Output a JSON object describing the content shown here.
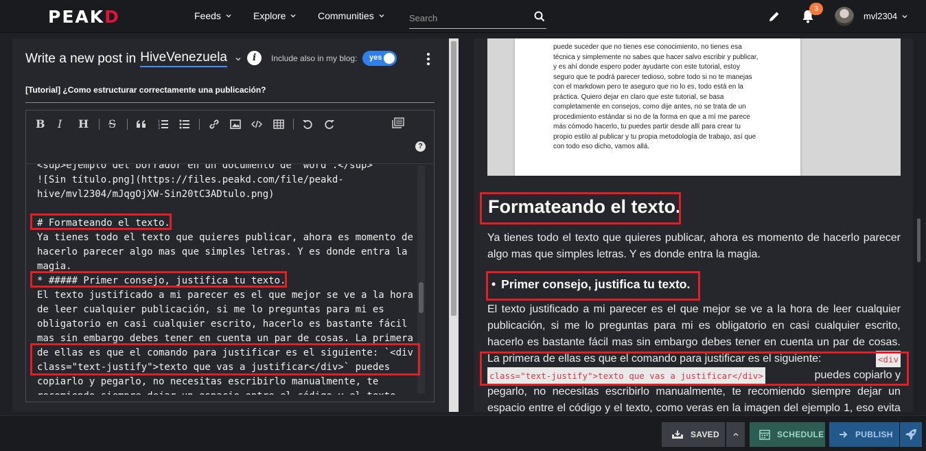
{
  "navbar": {
    "logo_main": "PEAK",
    "logo_accent": "D",
    "feeds": "Feeds",
    "explore": "Explore",
    "communities": "Communities",
    "search_placeholder": "Search",
    "notifications_count": "3",
    "username": "mvl2304"
  },
  "editor": {
    "write_prefix": "Write a new post in",
    "community": "HiveVenezuela",
    "include_label": "Include also in my blog:",
    "toggle_label": "yes",
    "post_title": "[Tutorial] ¿Como estructurar correctamente una publicación?",
    "toolbar": [
      "B",
      "I",
      "H",
      "S",
      "quote",
      "ordered-list",
      "unordered-list",
      "link",
      "image",
      "code",
      "table",
      "undo",
      "redo",
      "preview"
    ],
    "code_lines": [
      "<sup>ejemplo del borrador en un documento de \"word\".</sup>",
      "![Sin título.png](https://files.peakd.com/file/peakd-",
      "hive/mvl2304/mJqgOjXW-Sin20tC3ADtulo.png)",
      "",
      "# Formateando el texto.",
      "Ya tienes todo el texto que quieres publicar, ahora es momento de",
      "hacerlo parecer algo mas que simples letras. Y es donde entra la",
      "magia.",
      "* ##### Primer consejo, justifica tu texto.",
      "El texto justificado a mi parecer es el que mejor se ve a la hora",
      "de leer cualquier publicación, si me lo preguntas para mi es",
      "obligatorio en casi cualquier escrito, hacerlo es bastante fácil",
      "mas sin embargo debes tener en cuenta un par de cosas. La primera",
      "de ellas es que el comando para justificar es el siguiente: `<div",
      "class=\"text-justify\">texto que vas a justificar</div>` puedes",
      "copiarlo y pegarlo, no necesitas escribirlo manualmente, te",
      "recomiendo siempre dejar un espacio entre el código y el texto"
    ]
  },
  "preview": {
    "image_text": [
      "puede suceder que no tienes ese conocimiento, no tienes esa",
      "técnica y simplemente no sabes que hacer salvo escribir y publicar,",
      "y es ahí donde espero poder ayudarte con este tutorial, estoy",
      "seguro que te podrá parecer tedioso, sobre todo si no te manejas",
      "con el markdown pero te aseguro que no lo es, todo está en la",
      "práctica. Quiero dejar en claro que este tutorial, se basa",
      "completamente en consejos, como dije antes, no se trata de un",
      "procedimiento estándar si no de la forma en que a mí me parece",
      "más cómodo hacerlo, tu puedes partir desde allí para crear tu",
      "propio estilo al publicar y tu propia metodología de trabajo, así que",
      "con todo eso dicho, vamos allá."
    ],
    "heading": "Formateando el texto.",
    "intro_lines": [
      "Ya tienes todo el texto que quieres publicar, ahora es momento de hacerlo parecer",
      "algo mas que simples letras. Y es donde entra la magia."
    ],
    "bullet": "Primer consejo, justifica tu texto.",
    "body_lines": [
      "El texto justificado a mi parecer es el que mejor se ve a la hora de leer cualquier",
      "publicación, si me lo preguntas para mi es obligatorio en casi cualquier escrito,",
      "hacerlo es bastante fácil mas sin embargo debes tener en cuenta un par de cosas."
    ],
    "code_intro": "La primera de ellas es que el comando para justificar es el siguiente:",
    "code_part1": "<div",
    "code_part2": "class=\"text-justify\">texto que vas a justificar</div>",
    "code_after": "puedes copiarlo y",
    "tail_lines": [
      "pegarlo, no necesitas escribirlo manualmente, te recomiendo siempre dejar un",
      "espacio entre el código y el texto, como veras en la imagen del ejemplo 1, eso evita"
    ]
  },
  "footer": {
    "saved": "SAVED",
    "schedule": "SCHEDULE",
    "publish": "PUBLISH"
  },
  "colors": {
    "accent_red": "#e31337",
    "highlight_box": "#e31e24",
    "toggle_blue": "#2f80ed",
    "badge_orange": "#f4793b"
  }
}
